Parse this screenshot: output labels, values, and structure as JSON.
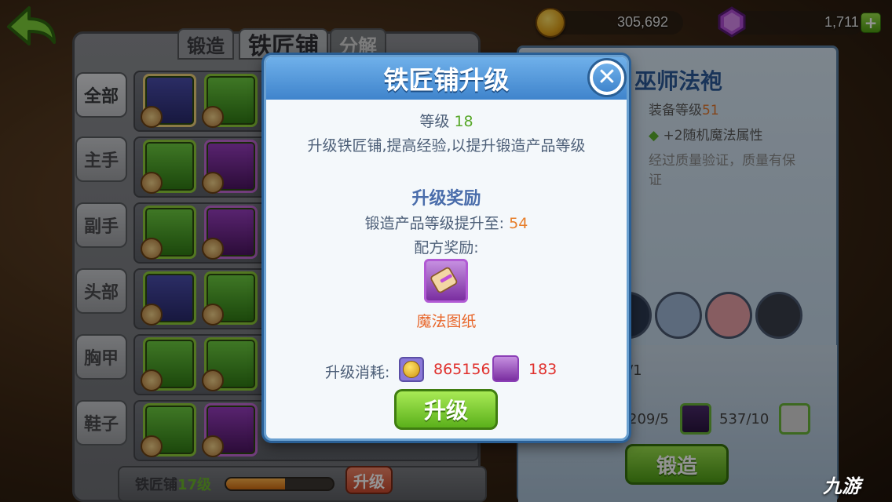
{
  "topbar": {
    "gold": "305,692",
    "gems": "1,711",
    "plus_label": "+"
  },
  "tabs": {
    "forge": "锻造",
    "smithy": "铁匠铺",
    "decompose": "分解"
  },
  "categories": [
    "全部",
    "主手",
    "副手",
    "头部",
    "胸甲",
    "鞋子"
  ],
  "bottom_bar": {
    "label": "铁匠铺",
    "level": "17级",
    "upgrade": "升级",
    "progress": 0.55
  },
  "item_detail": {
    "name": "巫师法袍",
    "equip_level_label": "装备等级",
    "equip_level": "51",
    "attr_prefix": "+2",
    "attr_text": "随机魔法属性",
    "desc": "经过质量验证，质量有保证",
    "mat1_count": "/1",
    "mat2_count": "209/5",
    "mat3_count": "537/10",
    "forge_label": "锻造"
  },
  "modal": {
    "title": "铁匠铺升级",
    "level_label": "等级",
    "level": "18",
    "desc": "升级铁匠铺,提高经验,以提升锻造产品等级",
    "reward_title": "升级奖励",
    "product_level_label": "锻造产品等级提升至:",
    "product_level": "54",
    "recipe_label": "配方奖励:",
    "recipe_name": "魔法图纸",
    "cost_label": "升级消耗:",
    "cost_gold": "865156",
    "cost_scroll": "183",
    "upgrade_label": "升级",
    "close_label": "✕"
  },
  "watermark": "九游",
  "colors": {
    "accent_blue": "#3f84cc",
    "green_button": "#5bb01b",
    "cost_red": "#e0312d",
    "level_green": "#58a82a",
    "orange_value": "#e77e2a"
  }
}
